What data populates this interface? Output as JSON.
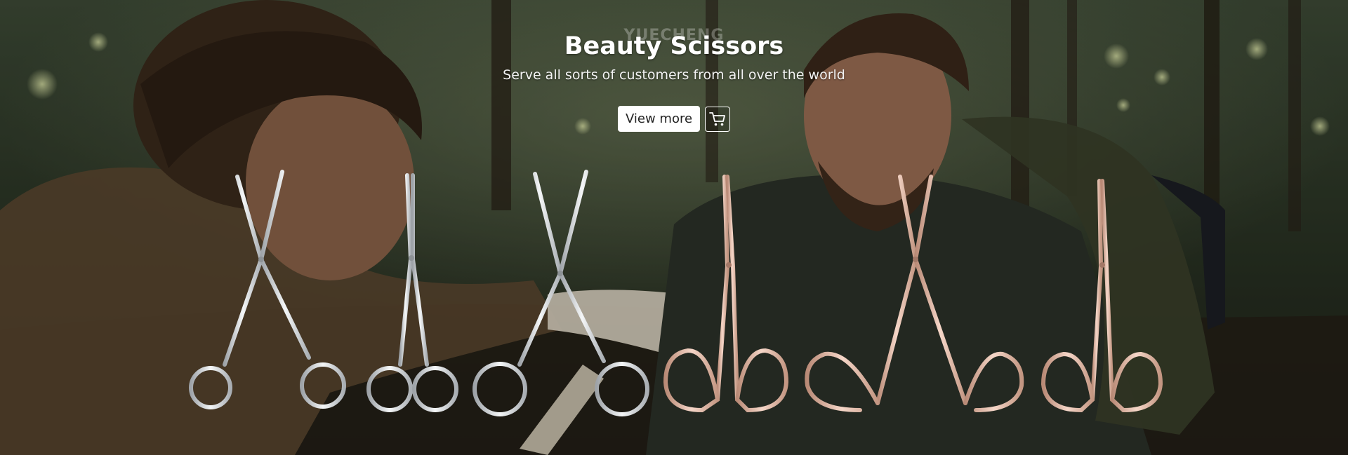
{
  "banner": {
    "watermark": "YUECHENG",
    "title": "Beauty Scissors",
    "subtitle": "Serve all sorts of customers from all over the world",
    "view_more_label": "View more",
    "cart_icon": "cart-icon"
  },
  "colors": {
    "button_bg": "#ffffff",
    "button_text": "#222222",
    "steel": "#d9dcdf",
    "rose_gold": "#e3b9a7"
  }
}
